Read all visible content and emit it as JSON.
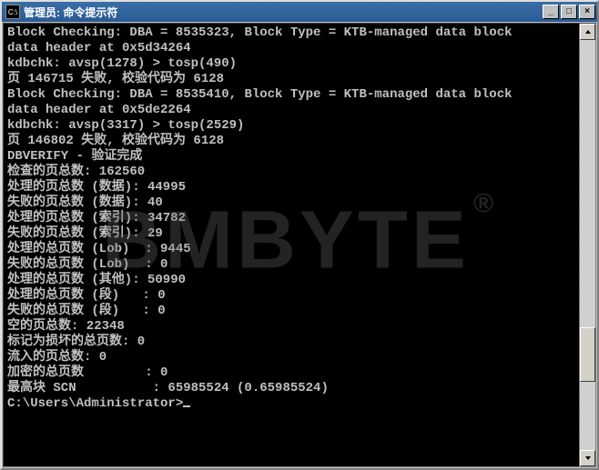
{
  "window": {
    "title": "管理员: 命令提示符",
    "icon_label": "C:\\",
    "buttons": {
      "minimize": "_",
      "maximize": "□",
      "close": "×"
    }
  },
  "console": {
    "lines": [
      "Block Checking: DBA = 8535323, Block Type = KTB-managed data block",
      "data header at 0x5d34264",
      "kdbchk: avsp(1278) > tosp(490)",
      "页 146715 失败, 校验代码为 6128",
      "Block Checking: DBA = 8535410, Block Type = KTB-managed data block",
      "data header at 0x5de2264",
      "kdbchk: avsp(3317) > tosp(2529)",
      "页 146802 失败, 校验代码为 6128",
      "",
      "",
      "DBVERIFY - 验证完成",
      "",
      "检查的页总数: 162560",
      "处理的页总数 (数据): 44995",
      "失败的页总数 (数据): 40",
      "处理的页总数 (索引): 34782",
      "失败的页总数 (索引): 29",
      "处理的总页数 (Lob)  : 9445",
      "失败的总页数 (Lob)  : 0",
      "处理的总页数 (其他): 50990",
      "处理的总页数 (段)   : 0",
      "失败的总页数 (段)   : 0",
      "空的页总数: 22348",
      "标记为损坏的总页数: 0",
      "流入的页总数: 0",
      "加密的总页数        : 0",
      "最高块 SCN          : 65985524 (0.65985524)",
      "",
      "C:\\Users\\Administrator>"
    ]
  },
  "watermark": {
    "text": "BMBYTE",
    "reg": "®"
  }
}
